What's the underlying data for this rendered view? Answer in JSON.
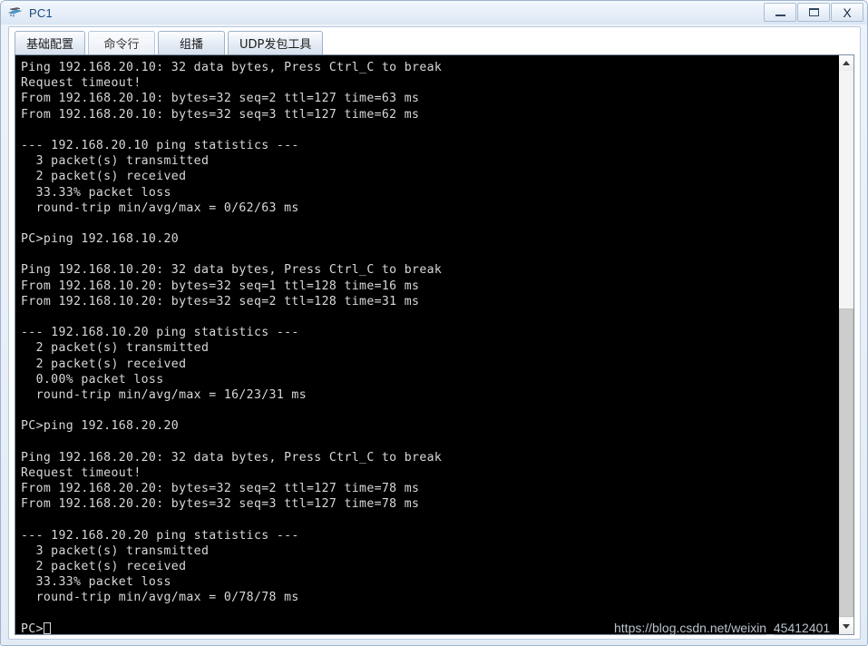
{
  "window": {
    "title": "PC1",
    "icon": "network-device-icon",
    "buttons": {
      "minimize": "minimize-icon",
      "maximize": "maximize-icon",
      "close": "X"
    }
  },
  "tabs": [
    {
      "label": "基础配置",
      "active": false
    },
    {
      "label": "命令行",
      "active": true
    },
    {
      "label": "组播",
      "active": false
    },
    {
      "label": "UDP发包工具",
      "active": false
    }
  ],
  "terminal": {
    "background": "#000000",
    "foreground": "#d8d8d8",
    "prompt": "PC>",
    "cursor_visible": true,
    "lines": [
      "Ping 192.168.20.10: 32 data bytes, Press Ctrl_C to break",
      "Request timeout!",
      "From 192.168.20.10: bytes=32 seq=2 ttl=127 time=63 ms",
      "From 192.168.20.10: bytes=32 seq=3 ttl=127 time=62 ms",
      "",
      "--- 192.168.20.10 ping statistics ---",
      "  3 packet(s) transmitted",
      "  2 packet(s) received",
      "  33.33% packet loss",
      "  round-trip min/avg/max = 0/62/63 ms",
      "",
      "PC>ping 192.168.10.20",
      "",
      "Ping 192.168.10.20: 32 data bytes, Press Ctrl_C to break",
      "From 192.168.10.20: bytes=32 seq=1 ttl=128 time=16 ms",
      "From 192.168.10.20: bytes=32 seq=2 ttl=128 time=31 ms",
      "",
      "--- 192.168.10.20 ping statistics ---",
      "  2 packet(s) transmitted",
      "  2 packet(s) received",
      "  0.00% packet loss",
      "  round-trip min/avg/max = 16/23/31 ms",
      "",
      "PC>ping 192.168.20.20",
      "",
      "Ping 192.168.20.20: 32 data bytes, Press Ctrl_C to break",
      "Request timeout!",
      "From 192.168.20.20: bytes=32 seq=2 ttl=127 time=78 ms",
      "From 192.168.20.20: bytes=32 seq=3 ttl=127 time=78 ms",
      "",
      "--- 192.168.20.20 ping statistics ---",
      "  3 packet(s) transmitted",
      "  2 packet(s) received",
      "  33.33% packet loss",
      "  round-trip min/avg/max = 0/78/78 ms",
      ""
    ]
  },
  "scrollbar": {
    "up_arrow": "chevron-up-icon",
    "down_arrow": "chevron-down-icon"
  },
  "watermark": {
    "text": "https://blog.csdn.net/weixin_45412401"
  }
}
